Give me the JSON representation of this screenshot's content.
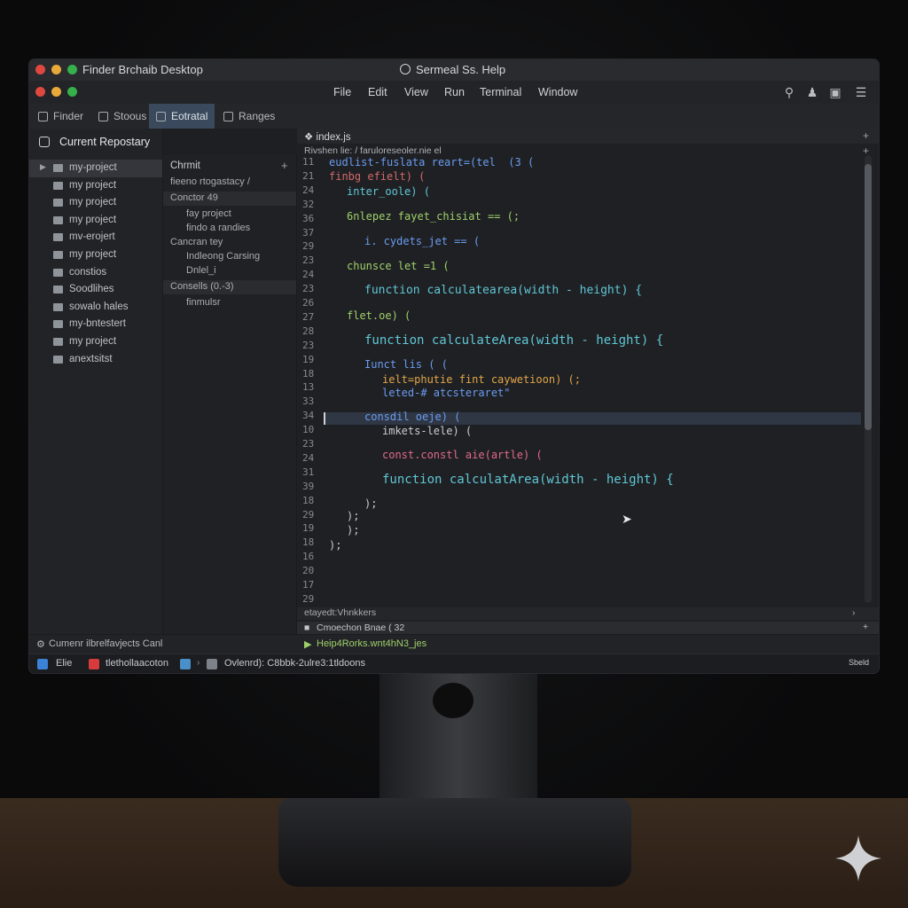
{
  "window": {
    "app_title": "Finder Brchaib Desktop",
    "center_title": "Sermeal Ss. Help"
  },
  "menu": {
    "items": [
      "File",
      "Edit",
      "View",
      "Run",
      "Terminal",
      "Window"
    ],
    "icons": [
      "search-icon",
      "user-icon",
      "folder-icon",
      "list-icon"
    ]
  },
  "tabs": [
    {
      "label": "Finder",
      "icon": "finder-icon",
      "active": false
    },
    {
      "label": "Stoous",
      "icon": "stack-icon",
      "active": false
    },
    {
      "label": "Eotratal",
      "icon": "window-icon",
      "active": true
    },
    {
      "label": "Ranges",
      "icon": "list-icon",
      "active": false
    }
  ],
  "sidebar": {
    "header": "Current Repostary",
    "items": [
      {
        "label": "my-project",
        "selected": true,
        "expandable": true
      },
      {
        "label": "my project"
      },
      {
        "label": "my project"
      },
      {
        "label": "my project"
      },
      {
        "label": "mv-erojert"
      },
      {
        "label": "my project"
      },
      {
        "label": "constios"
      },
      {
        "label": "Soodlihes"
      },
      {
        "label": "sowalo hales"
      },
      {
        "label": "my-bntestert"
      },
      {
        "label": "my project"
      },
      {
        "label": "anextsitst"
      }
    ]
  },
  "column2": {
    "header": "Chrmit",
    "rows": [
      {
        "text": "fieeno rtogastacy /",
        "kind": "plain"
      },
      {
        "text": "Conctor 49",
        "kind": "bar"
      },
      {
        "text": "fay project",
        "kind": "indent"
      },
      {
        "text": "findo a randies",
        "kind": "indent"
      },
      {
        "text": "Cancran tey",
        "kind": "plain"
      },
      {
        "text": "Indleong Carsing",
        "kind": "indent"
      },
      {
        "text": "Dnlel_i",
        "kind": "indent"
      },
      {
        "text": "Consells (0.-3)",
        "kind": "bar"
      },
      {
        "text": "finmulsr",
        "kind": "indent"
      }
    ]
  },
  "editor": {
    "tab": "index.js",
    "breadcrumb": "Rivshen  lie: /  faruloreseoler.nie  el",
    "line_numbers": [
      "11",
      "21",
      "24",
      "32",
      "36",
      "37",
      "29",
      "23",
      "24",
      "23",
      "26",
      "27",
      "28",
      "23",
      "19",
      "18",
      "13",
      "33",
      "34",
      "10",
      "23",
      "24",
      "31",
      "39",
      "18",
      "29",
      "19",
      "18",
      "16",
      "20",
      "17",
      "29"
    ],
    "lines": [
      {
        "text": "eudlist-fuslata reart=(tel  (3 (",
        "color": "#6a9cf0",
        "indent": 0,
        "size": 12
      },
      {
        "text": "finbg efielt) (",
        "color": "#d26a6a",
        "indent": 0,
        "size": 12
      },
      {
        "text": "inter_oole) (",
        "color": "#5fc7d6",
        "indent": 1,
        "size": 12
      },
      {
        "text": "6nlepez fayet_chisiat == (;",
        "color": "#9fd16b",
        "indent": 1,
        "size": 12
      },
      {
        "text": "i. cydets_jet == (",
        "color": "#6a9cf0",
        "indent": 2,
        "size": 12
      },
      {
        "text": "chunsce let =1 (",
        "color": "#9fd16b",
        "indent": 1,
        "size": 12
      },
      {
        "text": "function calculatearea(width - height) {",
        "color": "#5fc7d6",
        "indent": 2,
        "size": 13
      },
      {
        "text": "flet.oe) (",
        "color": "#9fd16b",
        "indent": 1,
        "size": 12
      },
      {
        "text": "function calculateArea(width - height) {",
        "color": "#5fc7d6",
        "indent": 2,
        "size": 14
      },
      {
        "text": "Iunct lis ( (",
        "color": "#6a9cf0",
        "indent": 2,
        "size": 12
      },
      {
        "text": "ielt=phutie fint caywetioon) (;",
        "color": "#e0a64a",
        "indent": 3,
        "size": 12
      },
      {
        "text": "leted-# atcsteraret\"",
        "color": "#6a9cf0",
        "indent": 3,
        "size": 12
      },
      {
        "text": "consdil oeje) (",
        "color": "#6a9cf0",
        "indent": 2,
        "size": 12
      },
      {
        "text": "imkets-lele) (",
        "color": "#c9ccd1",
        "indent": 3,
        "size": 12
      },
      {
        "text": "const.constl aie(artle) (",
        "color": "#e06a8a",
        "indent": 3,
        "size": 12
      },
      {
        "text": "function calculatArea(width - height) {",
        "color": "#5fc7d6",
        "indent": 3,
        "size": 14
      },
      {
        "text": ");",
        "color": "#c9ccd1",
        "indent": 2,
        "size": 12
      },
      {
        "text": ");",
        "color": "#c9ccd1",
        "indent": 1,
        "size": 12
      },
      {
        "text": ");",
        "color": "#c9ccd1",
        "indent": 1,
        "size": 12
      },
      {
        "text": ");",
        "color": "#c9ccd1",
        "indent": 0,
        "size": 12
      }
    ],
    "status_line": "etayedt:Vhnkkers",
    "console_label": "Cmoechon  Bnae ( 32",
    "terminal_line": "Heip4Rorks.wnt4hN3_jes"
  },
  "bottom": {
    "status": "Cumenr ilbrelfavjects Canl"
  },
  "pathbar": {
    "items": [
      "Elie",
      "tlethollaacoton",
      "Ovlenrd): C8bbk-2ulre3:1tldoons"
    ],
    "right": "Sbeld"
  },
  "colors": {
    "accent_tab": "#3a4a5c",
    "highlight": "#2f3745"
  }
}
